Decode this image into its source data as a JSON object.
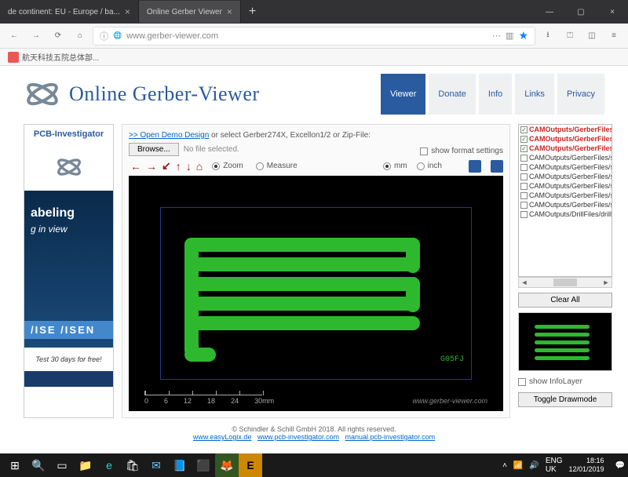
{
  "browser": {
    "tabs": [
      {
        "title": "de continent: EU - Europe / ba...",
        "active": false
      },
      {
        "title": "Online Gerber Viewer",
        "active": true
      }
    ],
    "url": "www.gerber-viewer.com",
    "bookmark": "航天科技五院总体部..."
  },
  "header": {
    "title": "Online Gerber-Viewer",
    "nav": [
      {
        "label": "Viewer",
        "active": true
      },
      {
        "label": "Donate"
      },
      {
        "label": "Info"
      },
      {
        "label": "Links"
      },
      {
        "label": "Privacy"
      }
    ]
  },
  "sidebar_ad": {
    "title": "PCB-Investigator",
    "line1": "abeling",
    "line2": "g in view",
    "band": "/ISE /ISEN",
    "foot": "Test 30 days for free!"
  },
  "controls": {
    "demo_link": ">> Open Demo Design",
    "demo_suffix": " or select Gerber274X, Excellon1/2 or Zip-File:",
    "browse": "Browse...",
    "no_file": "No file selected.",
    "zoom": "Zoom",
    "measure": "Measure",
    "show_format": "show format settings",
    "mm": "mm",
    "inch": "inch"
  },
  "viewer": {
    "scale_ticks": [
      "0",
      "6",
      "12",
      "18",
      "24",
      "30mm"
    ],
    "watermark": "www.gerber-viewer.com",
    "code": "G05FJ"
  },
  "layers": [
    {
      "name": "CAMOutputs/GerberFiles/c",
      "checked": true,
      "active": true
    },
    {
      "name": "CAMOutputs/GerberFiles/c",
      "checked": true,
      "active": true
    },
    {
      "name": "CAMOutputs/GerberFiles/p",
      "checked": true,
      "active": true
    },
    {
      "name": "CAMOutputs/GerberFiles/silk",
      "checked": false,
      "active": false
    },
    {
      "name": "CAMOutputs/GerberFiles/silk",
      "checked": false,
      "active": false
    },
    {
      "name": "CAMOutputs/GerberFiles/sol",
      "checked": false,
      "active": false
    },
    {
      "name": "CAMOutputs/GerberFiles/sol",
      "checked": false,
      "active": false
    },
    {
      "name": "CAMOutputs/GerberFiles/sol",
      "checked": false,
      "active": false
    },
    {
      "name": "CAMOutputs/GerberFiles/sol",
      "checked": false,
      "active": false
    },
    {
      "name": "CAMOutputs/DrillFiles/drills.",
      "checked": false,
      "active": false
    }
  ],
  "right": {
    "clear_all": "Clear All",
    "show_info": "show InfoLayer",
    "toggle": "Toggle Drawmode"
  },
  "footer": {
    "copy": "© Schindler & Schill GmbH 2018. All rights reserved.",
    "links": [
      "www.easyLogix.de",
      "www.pcb-investigator.com",
      "manual.pcb-investigator.com"
    ]
  },
  "taskbar": {
    "lang1": "ENG",
    "lang2": "UK",
    "time": "18:16",
    "date": "12/01/2019"
  }
}
